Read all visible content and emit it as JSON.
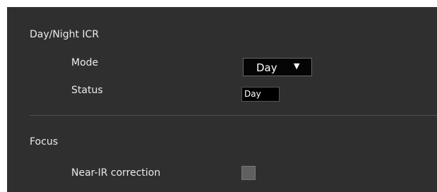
{
  "sections": {
    "day_night": {
      "title": "Day/Night ICR",
      "mode_label": "Mode",
      "mode_value": "Day",
      "status_label": "Status",
      "status_value": "Day"
    },
    "focus": {
      "title": "Focus",
      "near_ir_label": "Near-IR correction",
      "near_ir_checked": false
    }
  },
  "icons": {
    "dropdown_arrow": "chevron-down-icon"
  }
}
